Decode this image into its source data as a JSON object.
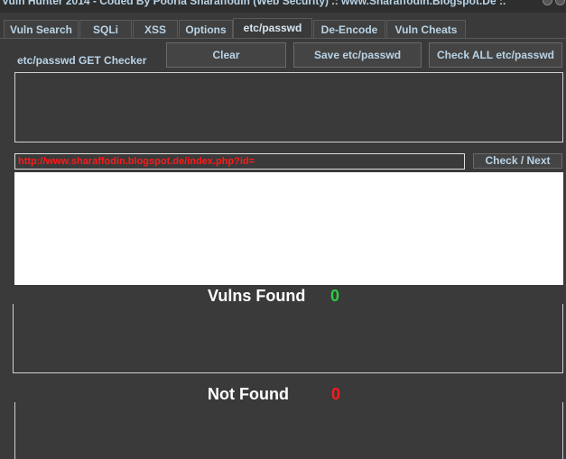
{
  "window": {
    "title": "Vuln Hunter 2014 - Coded By Pooria Sharaffodin (Web Security) .: www.Sharaffodin.Blogspot.De :."
  },
  "tabs": [
    {
      "label": "Vuln Search"
    },
    {
      "label": "SQLi"
    },
    {
      "label": "XSS"
    },
    {
      "label": "Options"
    },
    {
      "label": "etc/passwd",
      "active": true
    },
    {
      "label": "De-Encode"
    },
    {
      "label": "Vuln Cheats"
    }
  ],
  "checker": {
    "label": "etc/passwd GET Checker",
    "clear_label": "Clear",
    "save_label": "Save etc/passwd",
    "check_all_label": "Check ALL etc/passwd"
  },
  "url_input": {
    "value": "http://www.sharaffodin.blogspot.de/index.php?id="
  },
  "check_next_label": "Check / Next",
  "vulns_found": {
    "label": "Vulns Found",
    "count": "0"
  },
  "not_found": {
    "label": "Not Found",
    "count": "0"
  },
  "colors": {
    "background": "#3a3a3a",
    "label_blue": "#b9d3e6",
    "found_green": "#2ecc40",
    "not_found_red": "#ff1a1a",
    "url_red": "#ff1a1a"
  }
}
